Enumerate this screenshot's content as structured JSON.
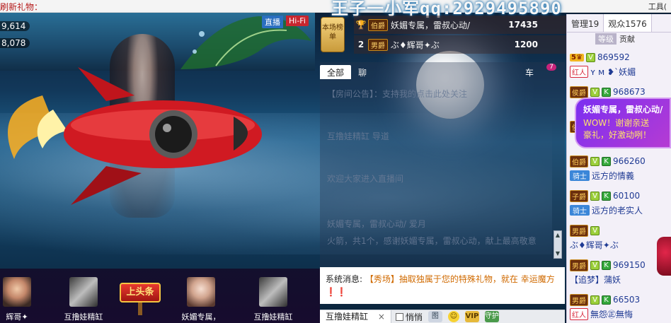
{
  "top_strip": {
    "left_fragment": "刷新礼物：",
    "right_fragment": "工具("
  },
  "overlay_text": "王子一小军qq:2929495890",
  "counters": [
    "9,614",
    "8,078"
  ],
  "stream_badges": {
    "live": "直播",
    "hifi": "Hi-Fi"
  },
  "rank": {
    "badge_label": "本场榜单",
    "rows": [
      {
        "rank": "",
        "noble": "伯爵",
        "name": "妖媚专属，雷叔心动/",
        "score": "17435"
      },
      {
        "rank": "2",
        "noble": "男爵",
        "name": "ぶ♦辉哥✦ぶ",
        "score": "1200"
      }
    ]
  },
  "chat": {
    "tabs": [
      "全部",
      "聊",
      "",
      ""
    ],
    "car_label": "车",
    "car_count": "7",
    "lines": [
      "【房间公告】：支持我的点击此处关注",
      "",
      "互撸娃精缸  导道",
      "",
      "欢迎大家进入直播间",
      "",
      "妖媚专属，雷叔心动/ 爱月",
      "火箭，共1个，感谢妖媚专属，雷叔心动，献上最高敬意"
    ],
    "system": {
      "label": "系统消息",
      "body": "【秀场】抽取独属于您的特殊礼物，就在 幸运魔方"
    },
    "system_prefix": "系统消息:",
    "system_suffix": "❗❗"
  },
  "input_bar": {
    "target": "互撸娃精缸",
    "close": "×",
    "whisper": "悄悄",
    "icons": {
      "image": "图",
      "emoji": "☺",
      "vip": "VIP",
      "guard": "守护"
    }
  },
  "gift_strip": {
    "items": [
      {
        "label": "辉哥✦"
      },
      {
        "label": "互撸娃精缸"
      },
      {
        "label": "妖媚专属，"
      },
      {
        "label": "互撸娃精缸"
      }
    ],
    "headline": "上头条"
  },
  "audience": {
    "tabs": {
      "admins": "管理19",
      "viewers": "观众1576"
    },
    "header": {
      "level": "等级",
      "contribution": "贡献"
    },
    "rows": [
      {
        "badges": [
          "crown:5",
          "v"
        ],
        "id": "869592",
        "line2_badge": "红人",
        "line2_name": "ʏ ᴍ ❥`妖媚"
      },
      {
        "badges": [
          "noble:侯爵",
          "v",
          "k"
        ],
        "id": "968673",
        "line2_badge": "",
        "line2_name": ""
      },
      {
        "badges": [
          "noble:侯爵",
          "v",
          "k"
        ],
        "id": "",
        "line2_badge": "",
        "line2_name": ""
      },
      {
        "badges": [
          "noble:伯爵",
          "v",
          "k"
        ],
        "id": "966260",
        "line2_badge": "骑士",
        "line2_name": "远方的情義"
      },
      {
        "badges": [
          "noble:子爵",
          "v",
          "k"
        ],
        "id": "60100",
        "line2_badge": "骑士",
        "line2_name": "远方的老实人"
      },
      {
        "badges": [
          "noble:男爵",
          "v"
        ],
        "id": "",
        "line2_badge": "",
        "line2_name": "ぶ♦辉哥✦ぶ"
      },
      {
        "badges": [
          "noble:男爵",
          "v",
          "k"
        ],
        "id": "969150",
        "line2_badge": "",
        "line2_name": "【追梦】蒲妖"
      },
      {
        "badges": [
          "noble:男爵",
          "v",
          "k"
        ],
        "id": "66503",
        "line2_badge": "红人",
        "line2_name": "無怨㊣無悔"
      }
    ],
    "row_badge_labels": {
      "v": "V",
      "k": "K"
    },
    "bubble": {
      "l1": "妖媚专属，雷叔心动/",
      "l2": "WOW！谢谢亲送",
      "l3": "豪礼，好激动咧！"
    }
  },
  "colors": {
    "accent": "#c8262f",
    "link": "#1f3a93",
    "system": "#d06a00"
  }
}
